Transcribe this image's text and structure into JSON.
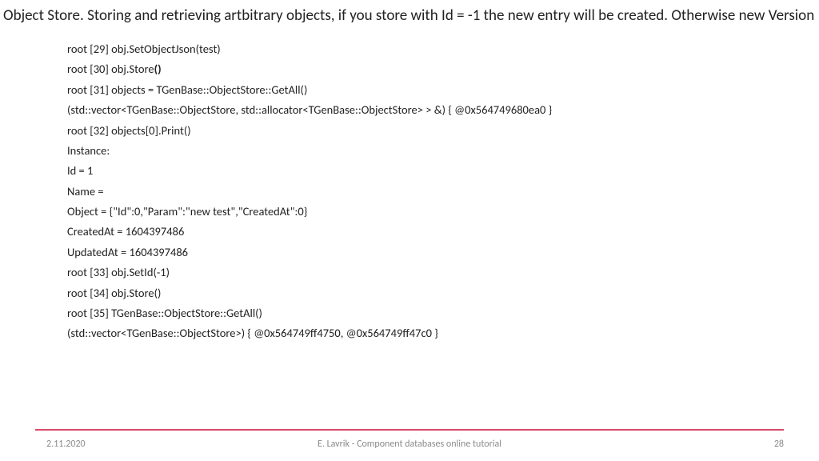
{
  "title": "Object Store. Storing and retrieving artbitrary objects, if you store with Id = -1 the new entry will be created. Otherwise new Version",
  "code": {
    "l1": "root [29] obj.SetObjectJson(test)",
    "l2a": "root [30] obj.Store",
    "l2b": "()",
    "l3": "root [31] objects = TGenBase::ObjectStore::GetAll()",
    "l4": "(std::vector<TGenBase::ObjectStore, std::allocator<TGenBase::ObjectStore> > &) { @0x564749680ea0 }",
    "l5": "root [32] objects[0].Print()",
    "l6": " Instance:",
    "l7": "Id = 1",
    "l8": "Name =",
    "l9": "Object = {\"Id\":0,\"Param\":\"new test\",\"CreatedAt\":0}",
    "l10": "CreatedAt = 1604397486",
    "l11": "UpdatedAt = 1604397486",
    "l12": "root [33] obj.SetId(-1)",
    "l13": "root [34] obj.Store()",
    "l14": "root [35] TGenBase::ObjectStore::GetAll()",
    "l15": "(std::vector<TGenBase::ObjectStore>) { @0x564749ff4750, @0x564749ff47c0 }"
  },
  "footer": {
    "date": "2.11.2020",
    "center": "E. Lavrik - Component databases online tutorial",
    "page": "28"
  }
}
